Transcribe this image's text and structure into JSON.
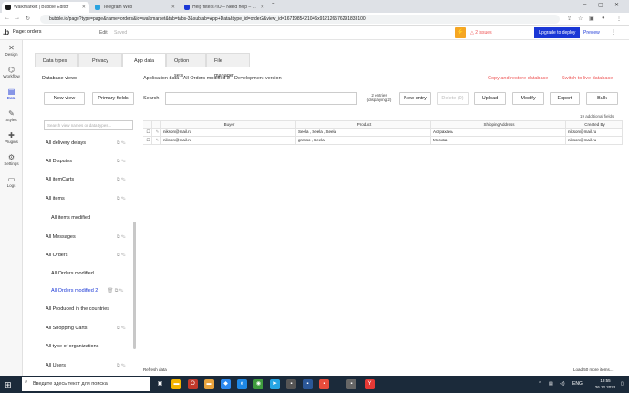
{
  "browser": {
    "tabs": [
      {
        "label": "Walkmarket | Bubble Editor",
        "color": "#1a1a1a"
      },
      {
        "label": "Telegram Web",
        "color": "#2aa3e0"
      },
      {
        "label": "Help filters?IO – Need help – ...",
        "color": "#1a37d6"
      }
    ],
    "url": "bubble.io/page?type=page&name=orders&id=walkmarket&tab=tabs-3&subtab=App+Data&type_id=order2&view_id=1671985421046x912126576291833100"
  },
  "header": {
    "page_select": "Page: orders",
    "edit": "Edit",
    "saved": "Saved",
    "issues": "2 issues",
    "deploy": "Upgrade to deploy",
    "preview": "Preview"
  },
  "leftnav": [
    {
      "label": "Design",
      "icon": "design-icon",
      "glyph": "✕"
    },
    {
      "label": "Workflow",
      "icon": "workflow-icon",
      "glyph": "⌬"
    },
    {
      "label": "Data",
      "icon": "data-icon",
      "glyph": "▤"
    },
    {
      "label": "Styles",
      "icon": "styles-icon",
      "glyph": "✎"
    },
    {
      "label": "Plugins",
      "icon": "plugins-icon",
      "glyph": "✚"
    },
    {
      "label": "Settings",
      "icon": "settings-icon",
      "glyph": "⚙"
    },
    {
      "label": "Logs",
      "icon": "logs-icon",
      "glyph": "▭"
    }
  ],
  "tabs": [
    "Data types",
    "Privacy",
    "App data",
    "Option sets",
    "File manager"
  ],
  "left_panel": {
    "title": "Database views",
    "new_view": "New view",
    "primary_fields": "Primary fields",
    "search_placeholder": "Search view names or data types...",
    "items": [
      {
        "label": "All delivery delays",
        "sub": false
      },
      {
        "label": "All Disputes",
        "sub": false
      },
      {
        "label": "All itemCarts",
        "sub": false
      },
      {
        "label": "All items",
        "sub": false
      },
      {
        "label": "All items modified",
        "sub": true
      },
      {
        "label": "All Messages",
        "sub": false
      },
      {
        "label": "All Orders",
        "sub": false
      },
      {
        "label": "All Orders modified",
        "sub": true
      },
      {
        "label": "All Orders modified 2",
        "sub": true
      },
      {
        "label": "All Produced in the countries",
        "sub": false
      },
      {
        "label": "All Shopping Carts",
        "sub": false
      },
      {
        "label": "All type of organizations",
        "sub": false
      },
      {
        "label": "All Users",
        "sub": false
      }
    ]
  },
  "main": {
    "title": "Application data - All Orders modified 2 - Development version",
    "copy_restore": "Copy and restore database",
    "switch_live": "Switch to live database",
    "search_label": "Search",
    "entries_line1": "2 entries",
    "entries_line2": "(displaying 2)",
    "new_entry": "New entry",
    "delete": "Delete (0)",
    "upload": "Upload",
    "modify": "Modify",
    "export": "Export",
    "bulk": "Bulk",
    "additional_fields": "19 additional fields",
    "columns": [
      "Buyer",
      "Product",
      "ShippingAddress",
      "Created By"
    ],
    "rows": [
      [
        "nikson@mail.ru",
        "Seela , Seela , Seela",
        "Астрахань",
        "nikson@mail.ru"
      ],
      [
        "nikson@mail.ru",
        "gresso , Seela",
        "Москва",
        "nikson@mail.ru"
      ]
    ],
    "refresh": "Refresh data",
    "load_more": "Load 50 more items..."
  },
  "taskbar": {
    "search": "Введите здесь текст для поиска",
    "lang": "ENG",
    "time": "19:55",
    "date": "26.12.2022"
  }
}
